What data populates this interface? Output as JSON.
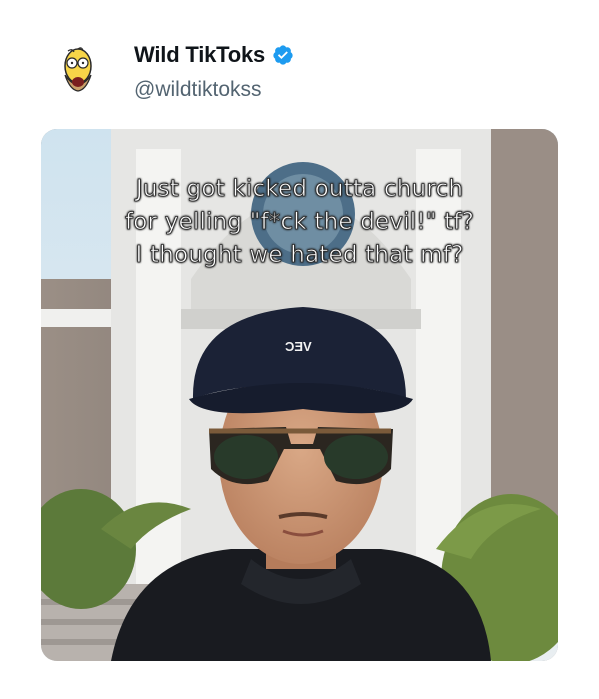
{
  "post": {
    "author_name": "Wild TikToks",
    "author_handle": "@wildtiktokss",
    "verified": true,
    "accent_color": "#1d9bf0"
  },
  "media": {
    "caption_lines": [
      "Just got kicked outta church",
      "for yelling \"f*ck the devil!\" tf?",
      "I thought we hated that mf?"
    ],
    "cap_logo_text": "ƆƎV"
  },
  "icons": {
    "avatar": "homer-simpson-avatar-icon",
    "verified": "verified-badge-icon"
  }
}
